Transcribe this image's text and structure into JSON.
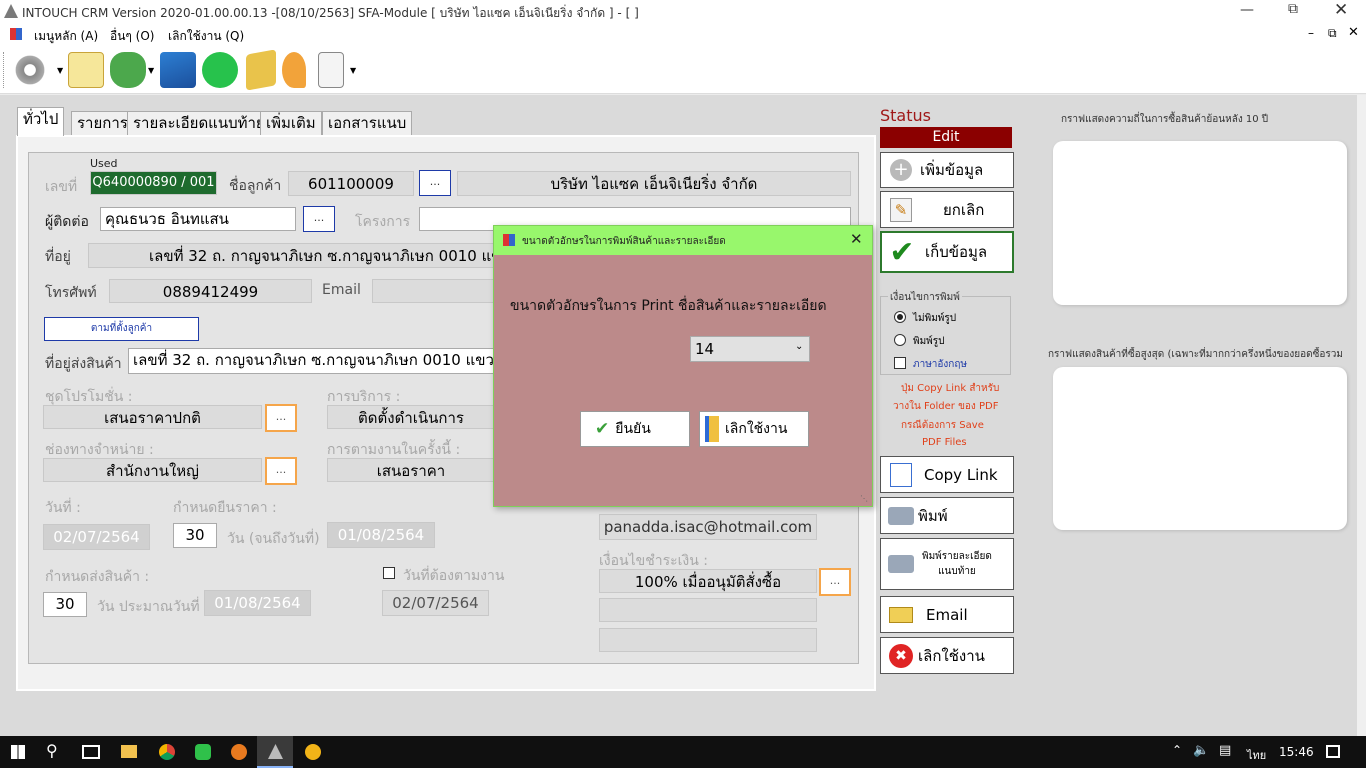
{
  "window": {
    "title": "INTOUCH CRM Version 2020-01.00.00.13 -[08/10/2563] SFA-Module  [ บริษัท ไอแซค เอ็นจิเนียริ่ง จำกัด ] - [ ]"
  },
  "menu": {
    "main": "เมนูหลัก (A)",
    "other": "อื่นๆ (O)",
    "exit": "เลิกใช้งาน (Q)"
  },
  "tabs": [
    "ทั่วไป",
    "รายการ",
    "รายละเอียดแนบท้าย",
    "เพิ่มเติม",
    "เอกสารแนบ"
  ],
  "form": {
    "used": "Used",
    "doc_no_label": "เลขที่",
    "doc_no": "Q640000890 / 001",
    "customer_label": "ชื่อลูกค้า",
    "customer_code": "601100009",
    "customer_name": "บริษัท ไอแซค เอ็นจิเนียริ่ง จำกัด",
    "contact_label": "ผู้ติดต่อ",
    "contact": "คุณธนวธ อินทแสน",
    "project_label": "โครงการ",
    "address_label": "ที่อยู่",
    "address": "เลขที่  32  ถ. กาญจนาภิเษก  ซ.กาญจนาภิเษก 0010    แข",
    "phone_label": "โทรศัพท์",
    "phone": "0889412499",
    "email_label": "Email",
    "same_as_customer": "ตามที่ตั้งลูกค้า",
    "ship_label": "ที่อยู่ส่งสินค้า",
    "ship_address": "เลขที่  32  ถ. กาญจนาภิเษก  ซ.กาญจนาภิเษก 0010    แขวง",
    "promo_label": "ชุดโปรโมชั่น :",
    "promo": "เสนอราคาปกติ",
    "service_label": "การบริการ :",
    "service": "ติดตั้งดำเนินการ",
    "channel_label": "ช่องทางจำหน่าย  :",
    "channel": "สำนักงานใหญ่",
    "followup_label": "การตามงานในครั้งนี้ :",
    "followup": "เสนอราคา",
    "date_label": "วันที่ :",
    "date": "02/07/2564",
    "confirm_label": "กำหนดยืนราคา :",
    "confirm_days": "30",
    "confirm_days_unit": "วัน (จนถึงวันที่)",
    "confirm_until": "01/08/2564",
    "delivery_label": "กำหนดส่งสินค้า :",
    "delivery_days": "30",
    "delivery_days_unit": "วัน ประมาณวันที่",
    "delivery_date": "01/08/2564",
    "followup_date_label": "วันที่ต้องตามงาน",
    "followup_date": "02/07/2564",
    "sale_email": "panadda.isac@hotmail.com",
    "payment_label": "เงื่อนไขชำระเงิน :",
    "payment": "100% เมื่ออนุมัติสั่งซื้อ",
    "dots": "..."
  },
  "status": {
    "title": "Status",
    "value": "Edit"
  },
  "actions": {
    "add": "เพิ่มข้อมูล",
    "cancel": "ยกเลิก",
    "save": "เก็บข้อมูล",
    "copy_link": "Copy Link",
    "print": "พิมพ์",
    "print_detail_1": "พิมพ์รายละเอียด",
    "print_detail_2": "แนบท้าย",
    "email": "Email",
    "exit": "เลิกใช้งาน"
  },
  "print_cond": {
    "title": "เงื่อนไขการพิมพ์",
    "no_image": "ไม่พิมพ์รูป",
    "with_image": "พิมพ์รูป",
    "english": "ภาษาอังกฤษ",
    "note": [
      "ปุ่ม Copy Link สำหรับ",
      "วางใน Folder ของ PDF",
      "กรณีต้องการ Save",
      "PDF Files"
    ]
  },
  "right_panel": {
    "chart1_title": "กราฟแสดงความถี่ในการซื้อสินค้าย้อนหลัง 10 ปี",
    "chart2_title": "กราฟแสดงสินค้าที่ซื้อสูงสุด (เฉพาะที่มากกว่าครึ่งหนึ่งของยอดซื้อรวม"
  },
  "dialog": {
    "title": "ขนาดตัวอักษรในการพิมพ์สินค้าและรายละเอียด",
    "message": "ขนาดตัวอักษรในการ Print ชื่อสินค้าและรายละเอียด",
    "font_size": "14",
    "ok": "ยืนยัน",
    "cancel": "เลิกใช้งาน"
  },
  "taskbar": {
    "lang": "ไทย",
    "time": "15:46"
  },
  "colors": {
    "accent_red": "#8b0000",
    "dialog_bg": "#bc8a8a",
    "dialog_title": "#98f76c",
    "doc_green": "#1e6b2e",
    "status_red": "#a01818"
  }
}
